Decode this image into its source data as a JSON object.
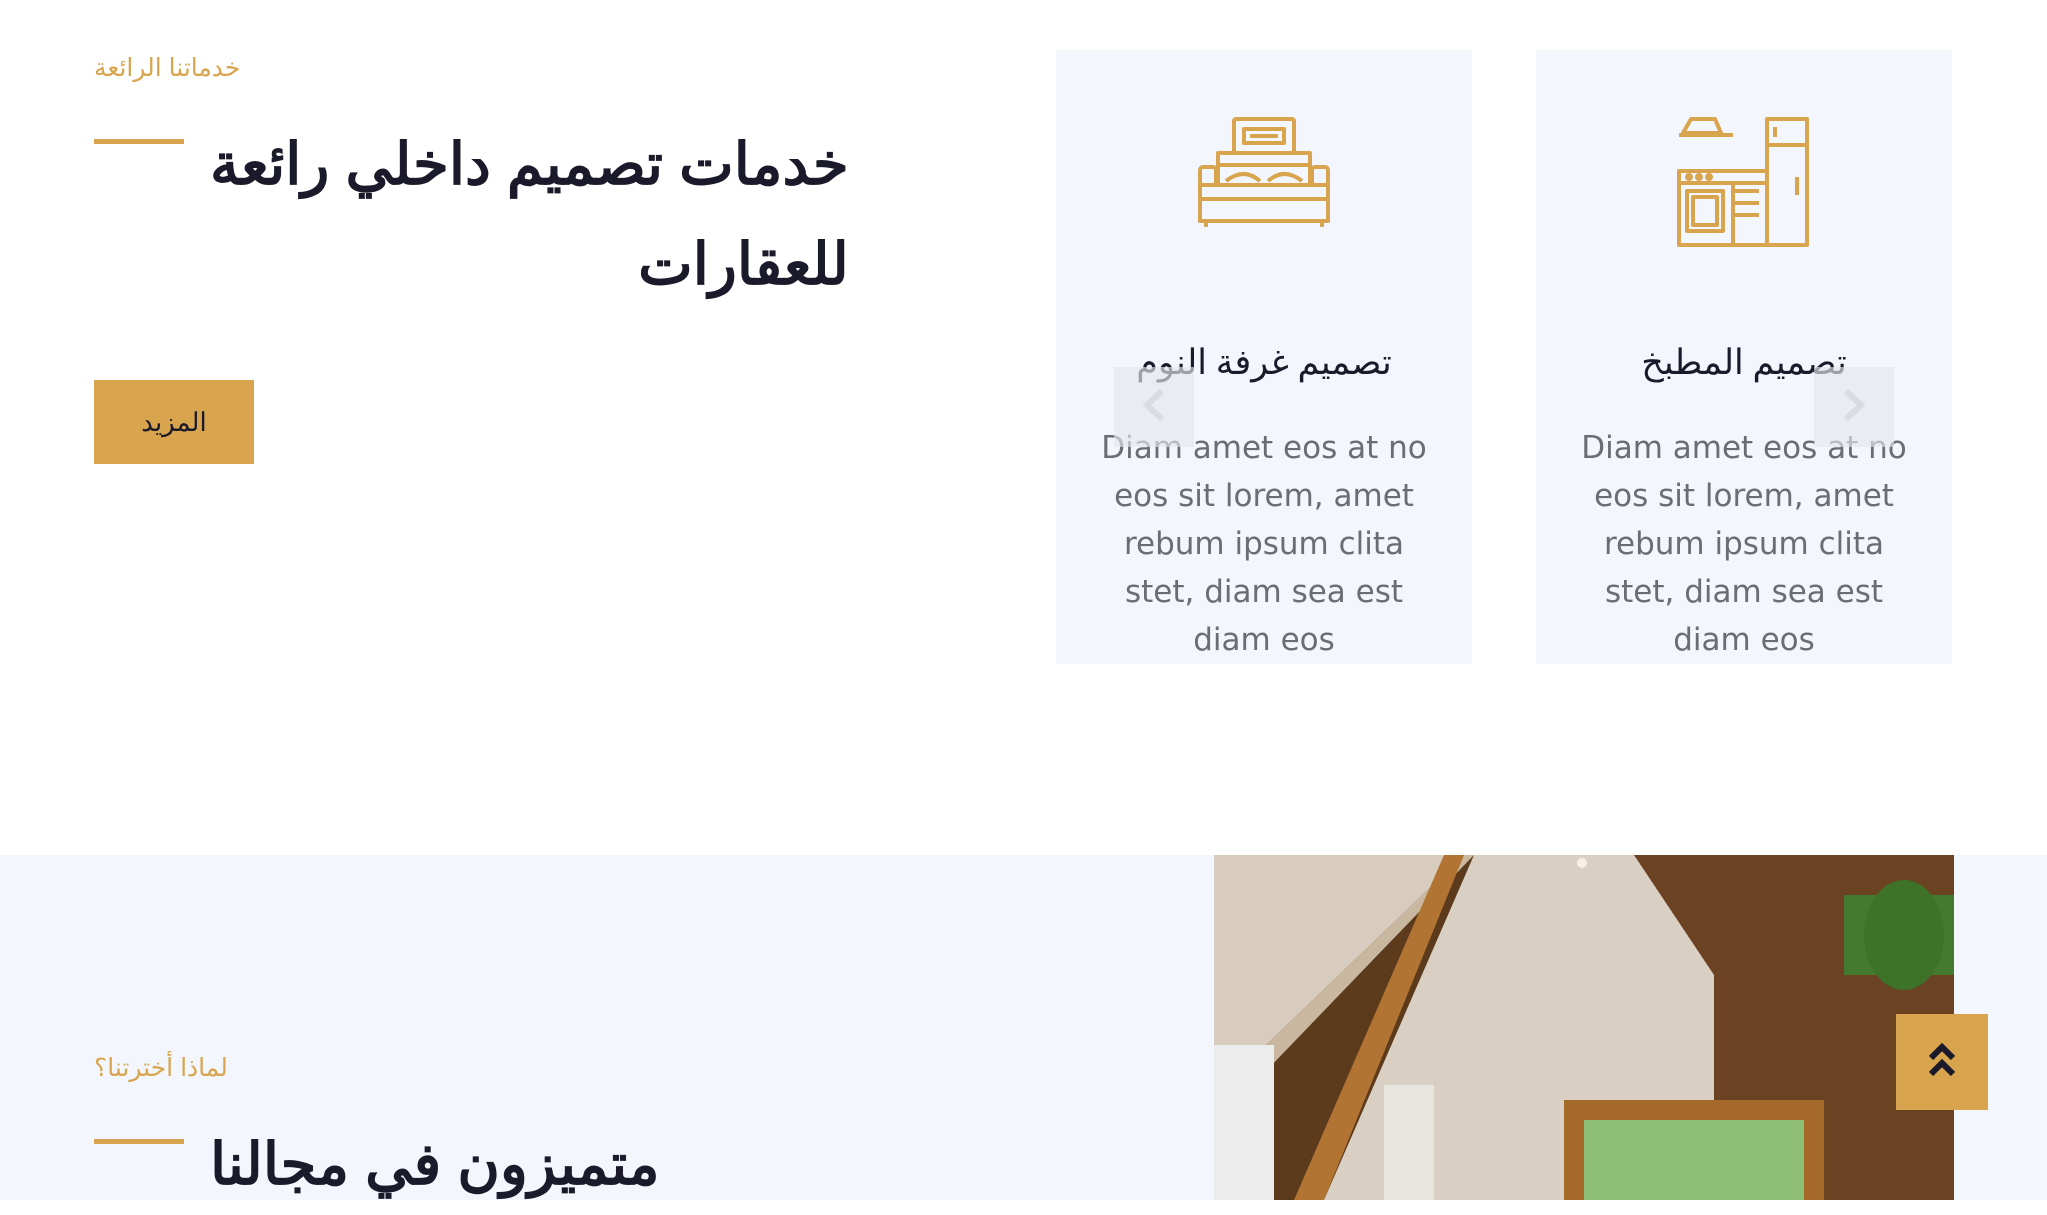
{
  "services": {
    "eyebrow": "خدماتنا الرائعة",
    "heading_line1": "خدمات تصميم داخلي رائعة",
    "heading_line2": "للعقارات",
    "more_button": "المزيد",
    "cards": [
      {
        "title": "تصميم غرفة النوم",
        "icon": "bed-icon",
        "text": "Diam amet eos at no eos sit lorem, amet rebum ipsum clita stet, diam sea est diam eos"
      },
      {
        "title": "تصميم المطبخ",
        "icon": "kitchen-icon",
        "text": "Diam amet eos at no eos sit lorem, amet rebum ipsum clita stet, diam sea est diam eos"
      }
    ],
    "prev_icon": "chevron-left-icon",
    "next_icon": "chevron-right-icon"
  },
  "why_us": {
    "eyebrow": "لماذا أخترتنا؟",
    "heading": "متميزون في مجالنا"
  },
  "back_to_top_icon": "double-chevron-up-icon",
  "colors": {
    "accent": "#D8A54E",
    "card_bg": "#F3F6FD",
    "heading": "#1a1a2a",
    "body_text": "#6c6c75"
  }
}
